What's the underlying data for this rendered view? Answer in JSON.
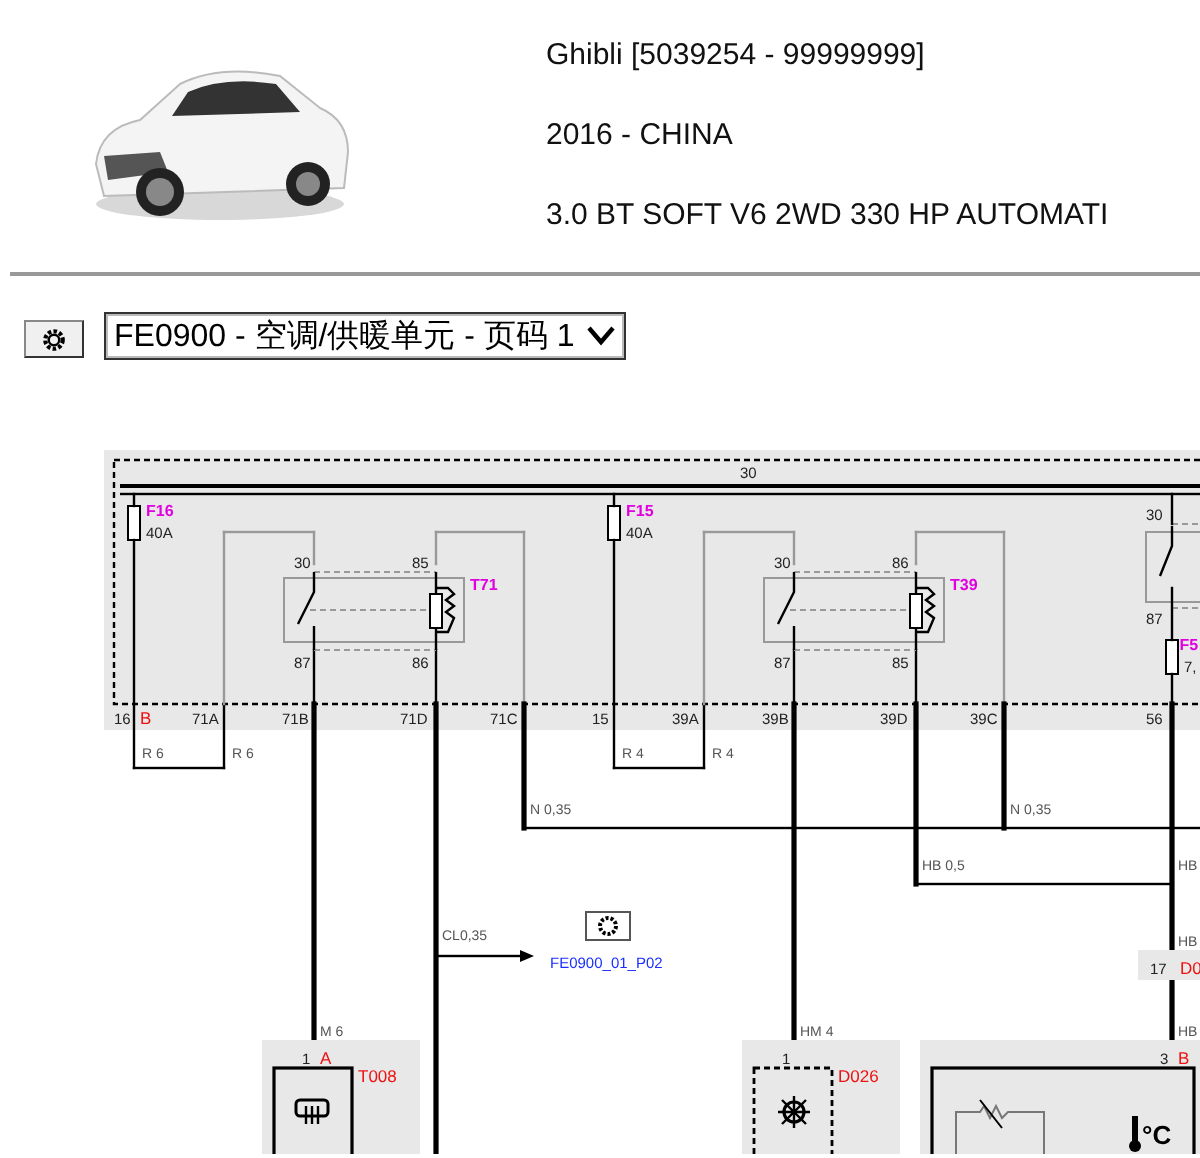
{
  "vehicle": {
    "model": "Ghibli [5039254 - 99999999]",
    "year_market": "2016 - CHINA",
    "engine": "3.0 BT SOFT V6 2WD 330 HP AUTOMATI"
  },
  "page_select": {
    "value": "FE0900 - 空调/供暖单元 - 页码 1"
  },
  "diagram": {
    "bus_label": "30",
    "fuses": [
      {
        "name": "F16",
        "rating": "40A"
      },
      {
        "name": "F15",
        "rating": "40A"
      },
      {
        "name": "F5",
        "rating": "7,"
      }
    ],
    "relays": [
      {
        "name": "T71",
        "pins": [
          "30",
          "85",
          "87",
          "86"
        ]
      },
      {
        "name": "T39",
        "pins": [
          "30",
          "86",
          "87",
          "85"
        ]
      },
      {
        "pins": [
          "30",
          "87"
        ]
      }
    ],
    "module_pins": [
      {
        "pin": "16",
        "code": "B"
      },
      {
        "pin": "71A"
      },
      {
        "pin": "71B"
      },
      {
        "pin": "71D"
      },
      {
        "pin": "71C"
      },
      {
        "pin": "15"
      },
      {
        "pin": "39A"
      },
      {
        "pin": "39B"
      },
      {
        "pin": "39D"
      },
      {
        "pin": "39C"
      },
      {
        "pin": "56"
      }
    ],
    "wire_labels": [
      "R 6",
      "R 6",
      "R 4",
      "R 4",
      "N 0,35",
      "N 0,35",
      "HB 0,5",
      "HB",
      "CL0,35",
      "HB",
      "M 6",
      "HM 4",
      "HB"
    ],
    "link": {
      "label": "FE0900_01_P02"
    },
    "inline_connector": {
      "pin": "17",
      "name": "D0"
    },
    "components": [
      {
        "kind": "heater",
        "name": "T008",
        "pin": "1",
        "code": "A"
      },
      {
        "kind": "compressor",
        "name": "D026",
        "pin": "1"
      },
      {
        "kind": "sensor",
        "pin": "3",
        "code": "B",
        "unit": "°C"
      }
    ]
  }
}
